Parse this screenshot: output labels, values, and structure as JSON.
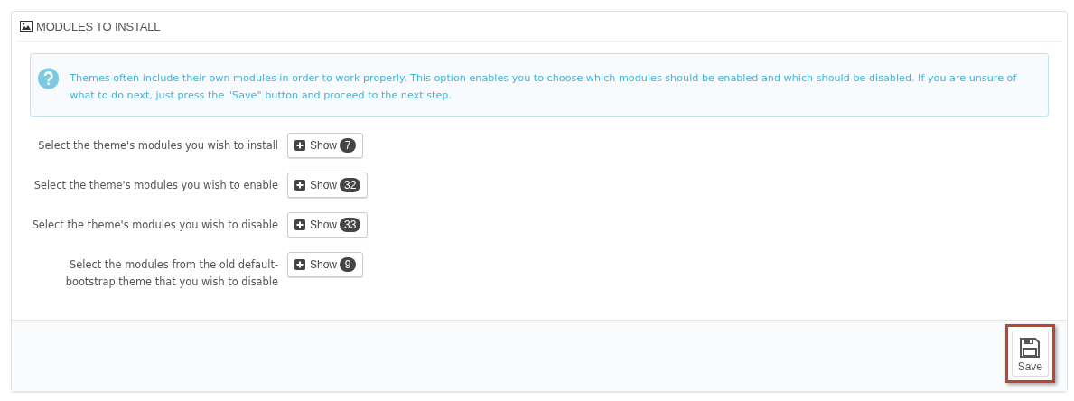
{
  "panel": {
    "title": "MODULES TO INSTALL"
  },
  "alert": {
    "text": "Themes often include their own modules in order to work properly. This option enables you to choose which modules should be enabled and which should be disabled. If you are unsure of what to do next, just press the \"Save\" button and proceed to the next step."
  },
  "rows": [
    {
      "label": "Select the theme's modules you wish to install",
      "button": "Show",
      "count": "7"
    },
    {
      "label": "Select the theme's modules you wish to enable",
      "button": "Show",
      "count": "32"
    },
    {
      "label": "Select the theme's modules you wish to disable",
      "button": "Show",
      "count": "33"
    },
    {
      "label": "Select the modules from the old default-bootstrap theme that you wish to disable",
      "button": "Show",
      "count": "9"
    }
  ],
  "save_button": {
    "label": "Save",
    "highlighted": true
  }
}
